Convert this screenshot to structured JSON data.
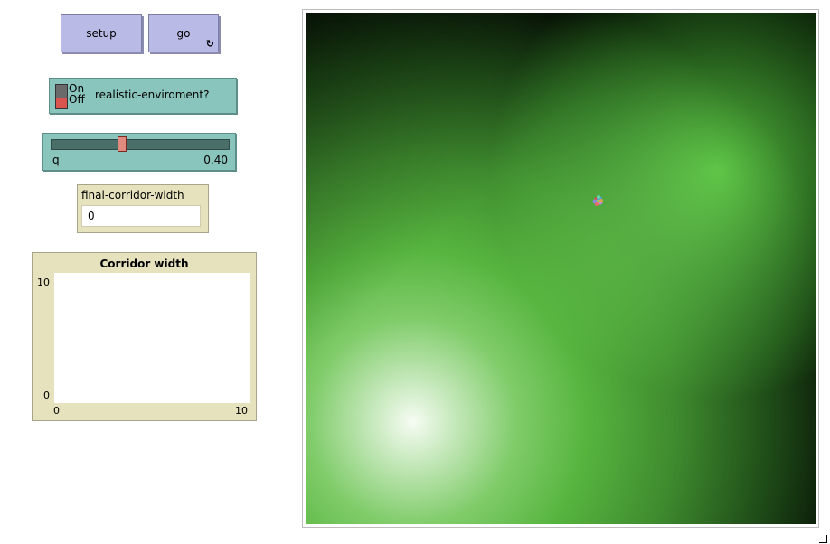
{
  "buttons": {
    "setup_label": "setup",
    "go_label": "go",
    "go_icon": "forever-icon"
  },
  "switch": {
    "on_label": "On",
    "off_label": "Off",
    "label": "realistic-enviroment?",
    "state": "off"
  },
  "slider": {
    "name": "q",
    "value_text": "0.40",
    "value": 0.4,
    "min": 0,
    "max": 1
  },
  "monitor": {
    "label": "final-corridor-width",
    "value": "0"
  },
  "plot": {
    "title": "Corridor width",
    "y_max": "10",
    "y_min": "0",
    "x_min": "0",
    "x_max": "10"
  },
  "colors": {
    "button_bg": "#babae6",
    "widget_teal": "#89c5bd",
    "monitor_bg": "#e5e2bd",
    "patch_green": "#57b53f"
  }
}
